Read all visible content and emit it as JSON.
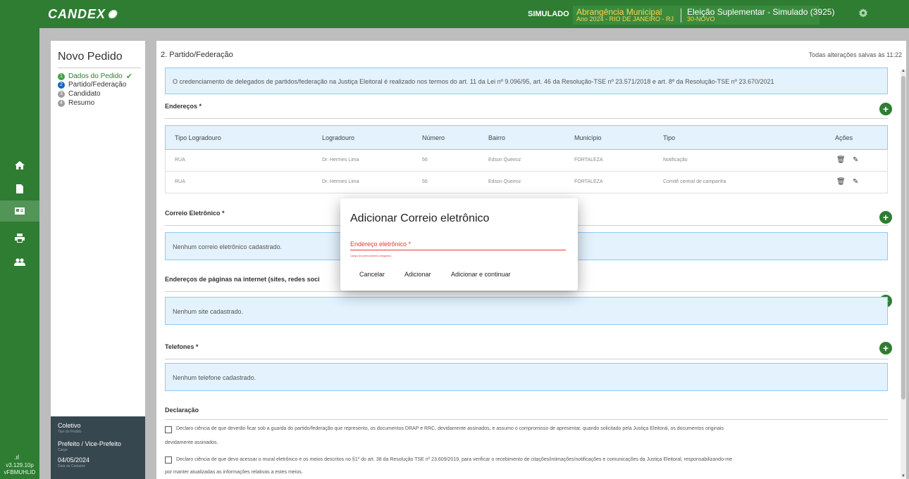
{
  "header": {
    "logo": "CANDEX",
    "mode": "SIMULADO",
    "abrangencia": "Abrangência Municipal",
    "ano_local": "Ano 2024 - RIO DE JANEIRO - RJ",
    "eleicao": "Eleição Suplementar - Simulado (3925)",
    "eleicao_sub": "30-NOVO"
  },
  "rail": {
    "icons": [
      "home-icon",
      "document-icon",
      "id-card-icon",
      "print-icon",
      "users-icon"
    ],
    "version": "v3.129.10p",
    "build": "vFBMUHLID"
  },
  "stepper": {
    "title": "Novo Pedido",
    "steps": [
      {
        "num": "1",
        "label": "Dados do Pedido"
      },
      {
        "num": "2",
        "label": "Partido/Federação"
      },
      {
        "num": "3",
        "label": "Candidato"
      },
      {
        "num": "4",
        "label": "Resumo"
      }
    ]
  },
  "meta": {
    "tipo": "Coletivo",
    "tipo_cap": "Tipo do Pedido",
    "cargo": "Prefeito / Vice-Prefeito",
    "cargo_cap": "Cargo",
    "data": "04/05/2024",
    "data_cap": "Data do Cadastro"
  },
  "main": {
    "title": "2. Partido/Federação",
    "saved": "Todas alterações salvas às 11:22",
    "info": "O credenciamento de delegados de partidos/federação na Justiça Eleitoral é realizado nos termos do art. 11 da Lei nº 9.096/95, art. 46 da Resolução-TSE nº 23.571/2018 e art. 8º da Resolução-TSE nº 23.670/2021",
    "enderecos_label": "Endereços *",
    "table": {
      "headers": [
        "Tipo Logradouro",
        "Logradouro",
        "Número",
        "Bairro",
        "Município",
        "Tipo",
        "Ações"
      ],
      "rows": [
        [
          "RUA",
          "Dr. Hermes Lima",
          "56",
          "Edson Queiroz",
          "FORTALEZA",
          "Notificação"
        ],
        [
          "RUA",
          "Dr. Hermes Lima",
          "56",
          "Edson Queiroz",
          "FORTALEZA",
          "Comitê central de campanha"
        ]
      ]
    },
    "email_label": "Correio Eletrônico *",
    "email_empty": "Nenhum correio eletrônico cadastrado.",
    "sites_label": "Endereços de páginas na internet (sites, redes soci",
    "sites_empty": "Nenhum site cadastrado.",
    "phones_label": "Telefones *",
    "phones_empty": "Nenhum telefone cadastrado.",
    "decl_label": "Declaração",
    "decl1a": "Declaro ciência de que deverão ficar sob a guarda do partido/federação que represento, os documentos DRAP e RRC, devidamente assinados, e assumo o compromisso de apresentar, quando solicitado pela Justiça Eleitoral, os documentos originais",
    "decl1b": "devidamente assinados.",
    "decl2a": "Declaro ciência de que devo acessar o mural eletrônico e os meios descritos no §1º do art. 38 da Resolução TSE nº 23.609/2019, para verificar o recebimento de citações/intimações/notificações e comunicações da Justiça Eleitoral, responsabilizando-me",
    "decl2b": "por manter atualizadas as informações relativas a estes meios."
  },
  "dialog": {
    "title": "Adicionar Correio eletrônico",
    "field_label": "Endereço eletrônico *",
    "error": "Campo de preenchimento obrigatório.",
    "cancel": "Cancelar",
    "add": "Adicionar",
    "add_continue": "Adicionar e continuar"
  },
  "colors": {
    "brand": "#2e7d32",
    "accent": "#ffd54f",
    "error": "#e53935",
    "info_bg": "#e3f2fd"
  }
}
